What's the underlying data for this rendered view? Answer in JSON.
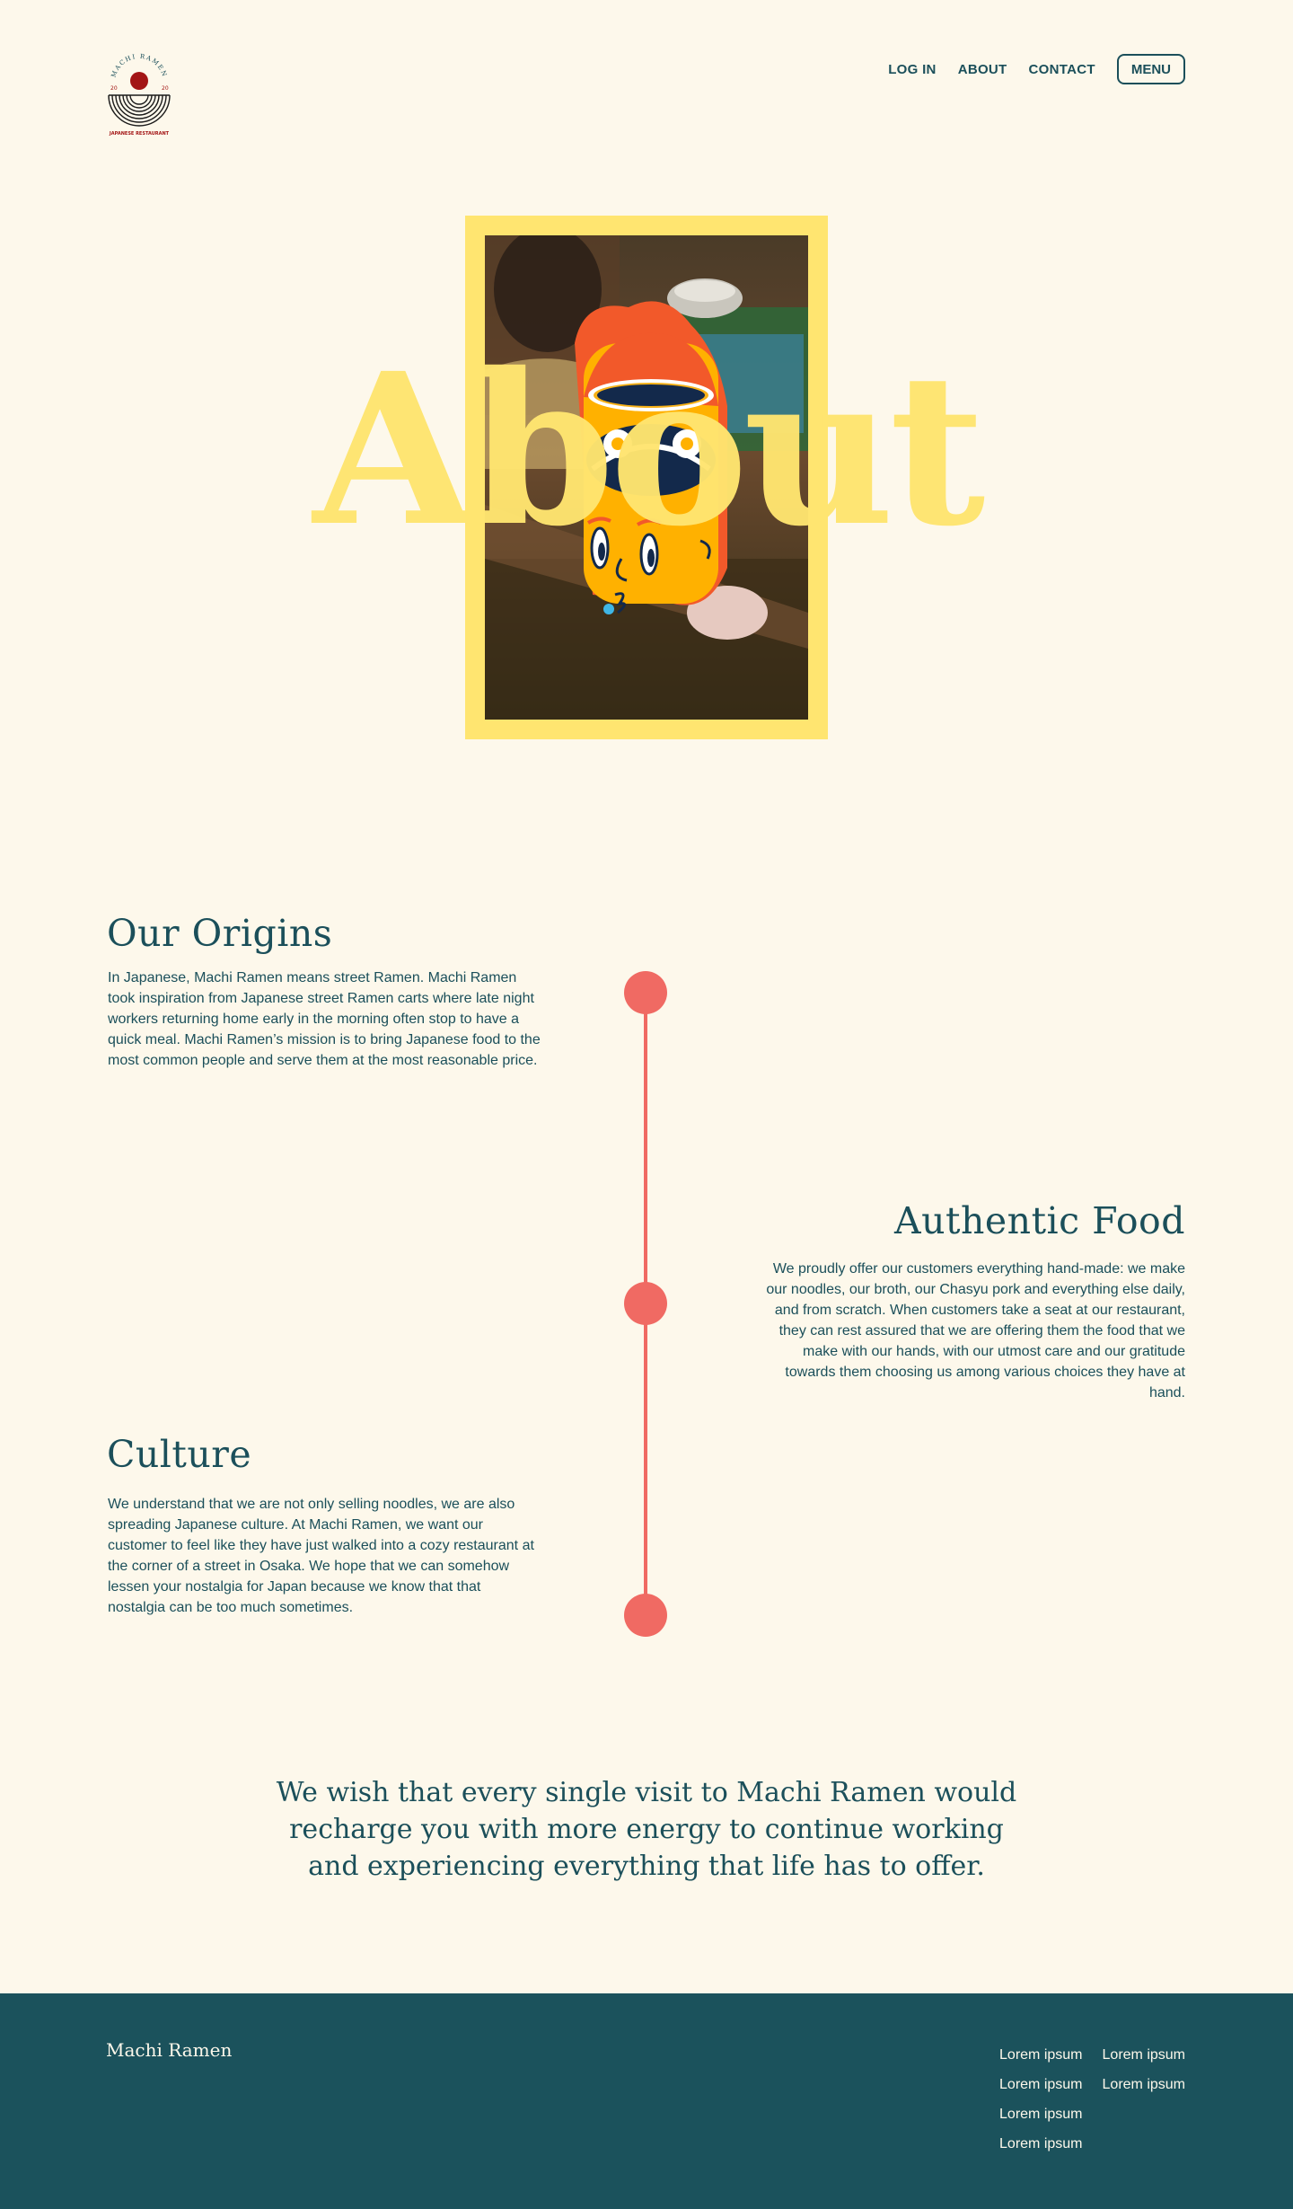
{
  "brand": {
    "logo_arc_text": "MACHI RAMEN",
    "logo_year_left": "20",
    "logo_year_right": "20",
    "logo_tagline": "JAPANESE RESTAURANT"
  },
  "nav": {
    "login": "LOG IN",
    "about": "ABOUT",
    "contact": "CONTACT",
    "menu": "MENU"
  },
  "hero": {
    "title": "About"
  },
  "sections": [
    {
      "title": "Our Origins",
      "text": "In Japanese, Machi Ramen means street Ramen. Machi Ramen took inspiration from Japanese street Ramen carts where late night workers returning home early in the morning often stop to have a quick meal. Machi Ramen’s mission is to bring Japanese food to the most common people and serve them at the most reasonable price."
    },
    {
      "title": "Authentic Food",
      "text": "We proudly offer our customers everything hand-made: we make our noodles, our broth, our Chasyu pork and everything else daily, and from scratch. When customers take a seat at our restaurant, they can rest assured that we are offering them the food that we make with our hands, with our utmost care and our gratitude towards them choosing us among various choices they have at hand."
    },
    {
      "title": "Culture",
      "text": "We understand that we are not only selling noodles, we are also spreading Japanese culture. At Machi Ramen, we want our customer to feel like they have just walked into a cozy restaurant at the corner of a street in Osaka. We hope that we can somehow lessen your nostalgia for Japan because we know that that nostalgia can be too much sometimes."
    }
  ],
  "quote": "We wish that every single visit to Machi Ramen would recharge you with more energy to continue working and experiencing everything that life has to offer.",
  "footer": {
    "brand": "Machi Ramen",
    "links": [
      "Lorem ipsum",
      "Lorem ipsum",
      "Lorem ipsum",
      "Lorem ipsum",
      "Lorem ipsum",
      "Lorem ipsum"
    ]
  },
  "colors": {
    "background": "#fdf8eb",
    "primary_text": "#1b4f5a",
    "accent_yellow": "#ffe570",
    "timeline_coral": "#f06a63",
    "footer_bg": "#1b525c",
    "logo_red": "#a31515"
  }
}
